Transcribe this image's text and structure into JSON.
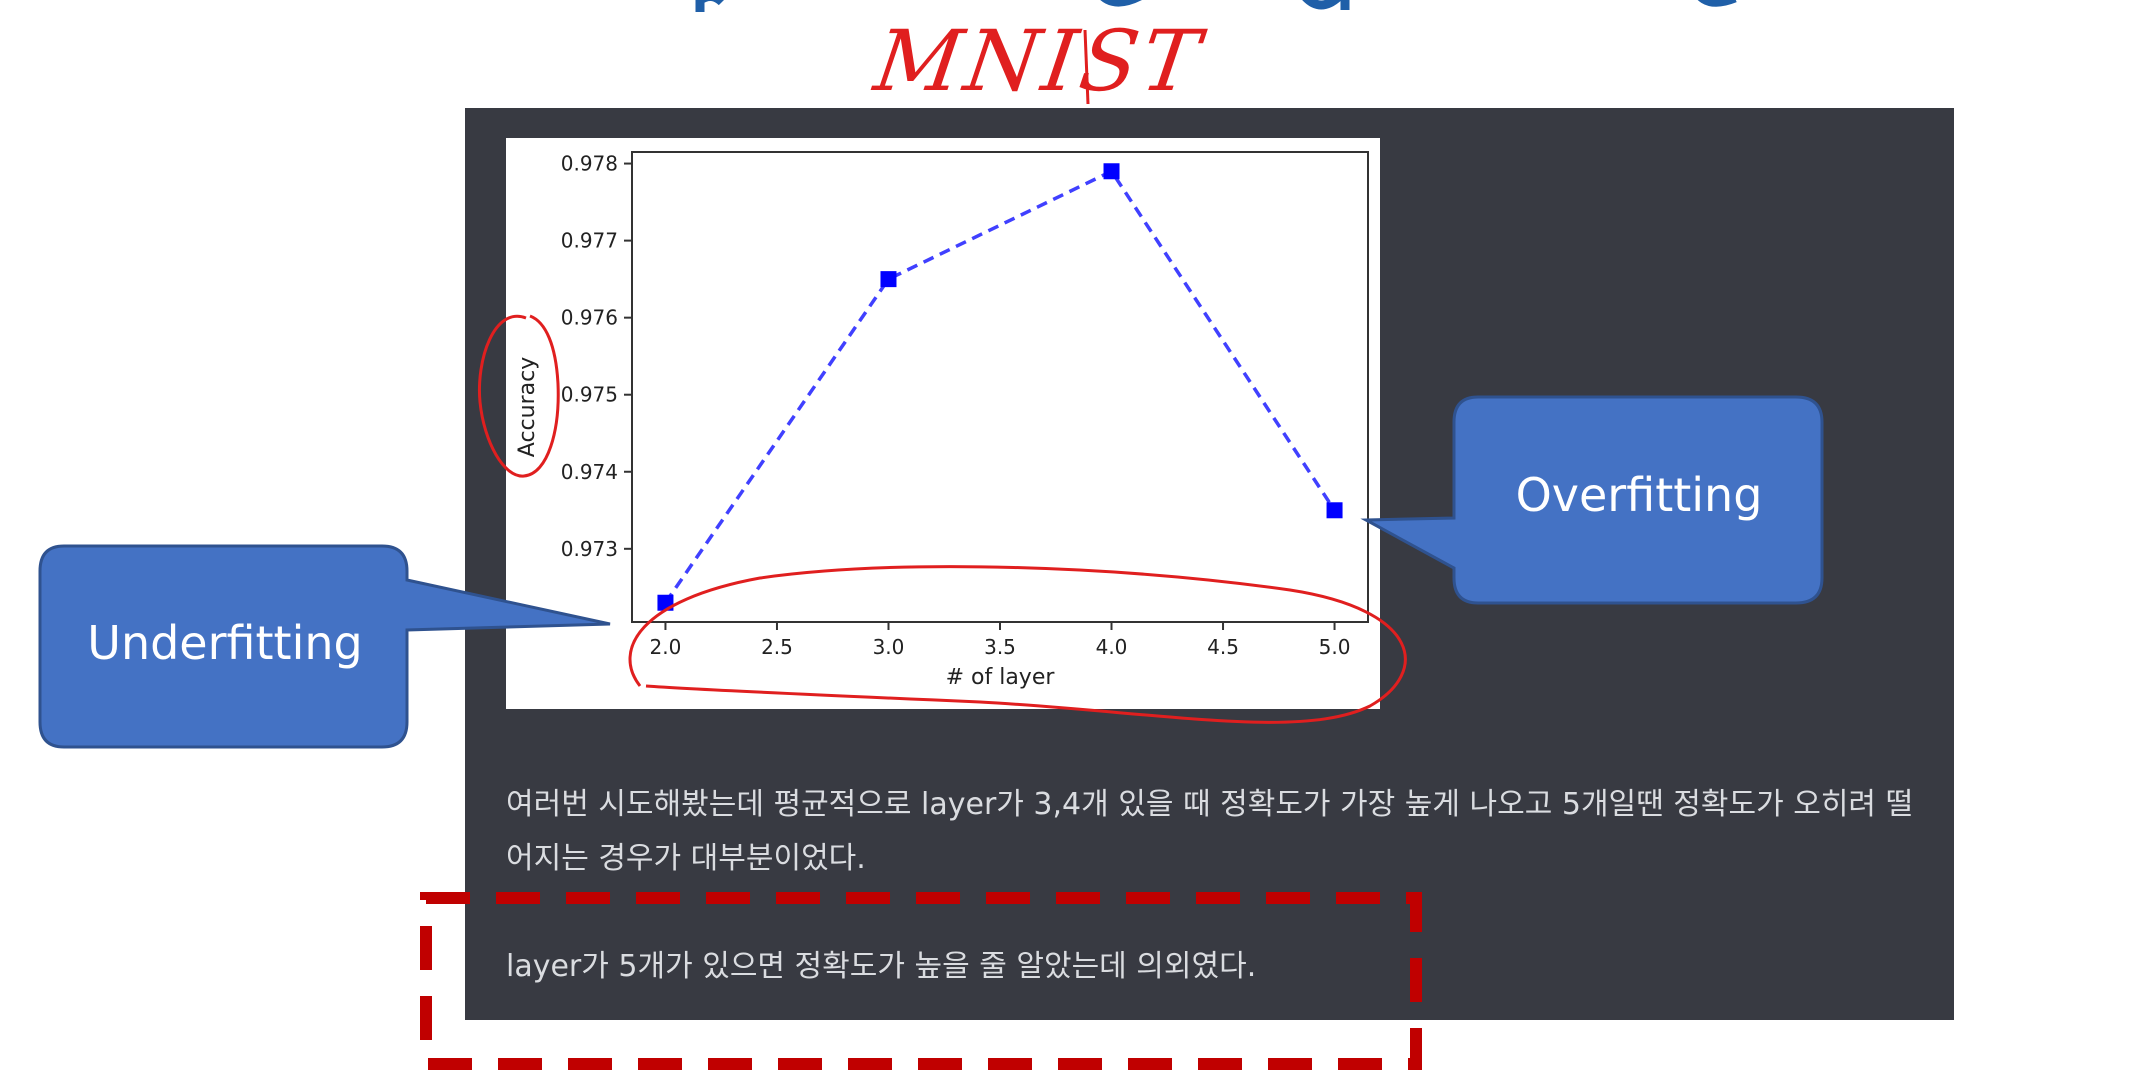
{
  "colors": {
    "panel_bg": "#383a42",
    "panel_text": "#dadce0",
    "callout_fill": "#4472c4",
    "callout_stroke": "#2f528f",
    "annotation_red": "#e01f1f",
    "dashed_box_red": "#c00000",
    "series_color": "#0000ff",
    "title_blue": "#1f5fa8"
  },
  "handwritten_note": "MNIST",
  "callouts": {
    "underfitting": "Underfitting",
    "overfitting": "Overfitting"
  },
  "paragraphs": {
    "first": "여러번 시도해봤는데 평균적으로 layer가 3,4개 있을 때 정확도가 가장 높게 나오고 5개일땐 정확도가 오히려 떨어지는 경우가 대부분이었다.",
    "second": "layer가 5개가 있으면 정확도가 높을 줄 알았는데 의외였다."
  },
  "icons": {
    "series_marker": "square-marker-icon"
  },
  "chart_data": {
    "type": "line",
    "x": [
      2.0,
      3.0,
      4.0,
      5.0
    ],
    "series": [
      {
        "values": [
          0.9723,
          0.9765,
          0.9779,
          0.9735
        ],
        "color": "#0000ff",
        "line_style": "dashed",
        "marker": "square"
      }
    ],
    "title": "",
    "xlabel": "# of layer",
    "ylabel": "Accuracy",
    "xlim": [
      1.85,
      5.15
    ],
    "ylim": [
      0.97205,
      0.97815
    ],
    "x_ticks": [
      2.0,
      2.5,
      3.0,
      3.5,
      4.0,
      4.5,
      5.0
    ],
    "x_tick_labels": [
      "2.0",
      "2.5",
      "3.0",
      "3.5",
      "4.0",
      "4.5",
      "5.0"
    ],
    "y_ticks": [
      0.973,
      0.974,
      0.975,
      0.976,
      0.977,
      0.978
    ],
    "y_tick_labels": [
      "0.973",
      "0.974",
      "0.975",
      "0.976",
      "0.977",
      "0.978"
    ],
    "grid": false,
    "legend": "none"
  }
}
